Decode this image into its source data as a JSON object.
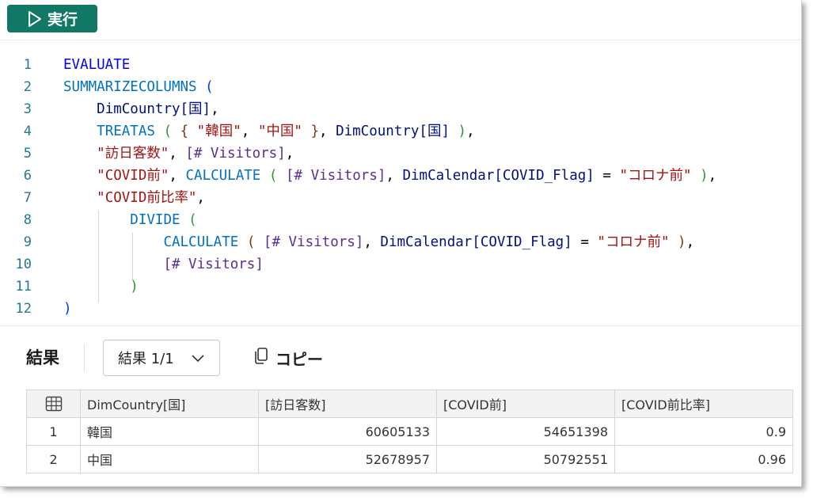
{
  "toolbar": {
    "run_label": "実行"
  },
  "editor": {
    "line_numbers": [
      "1",
      "2",
      "3",
      "4",
      "5",
      "6",
      "7",
      "8",
      "9",
      "10",
      "11",
      "12"
    ]
  },
  "results": {
    "label": "結果",
    "selector_value": "結果 1/1",
    "copy_label": "コピー",
    "columns": [
      "DimCountry[国]",
      "[訪日客数]",
      "[COVID前]",
      "[COVID前比率]"
    ],
    "rows": [
      {
        "index": "1",
        "cells": [
          "韓国",
          "60605133",
          "54651398",
          "0.9"
        ]
      },
      {
        "index": "2",
        "cells": [
          "中国",
          "52678957",
          "50792551",
          "0.96"
        ]
      }
    ]
  }
}
